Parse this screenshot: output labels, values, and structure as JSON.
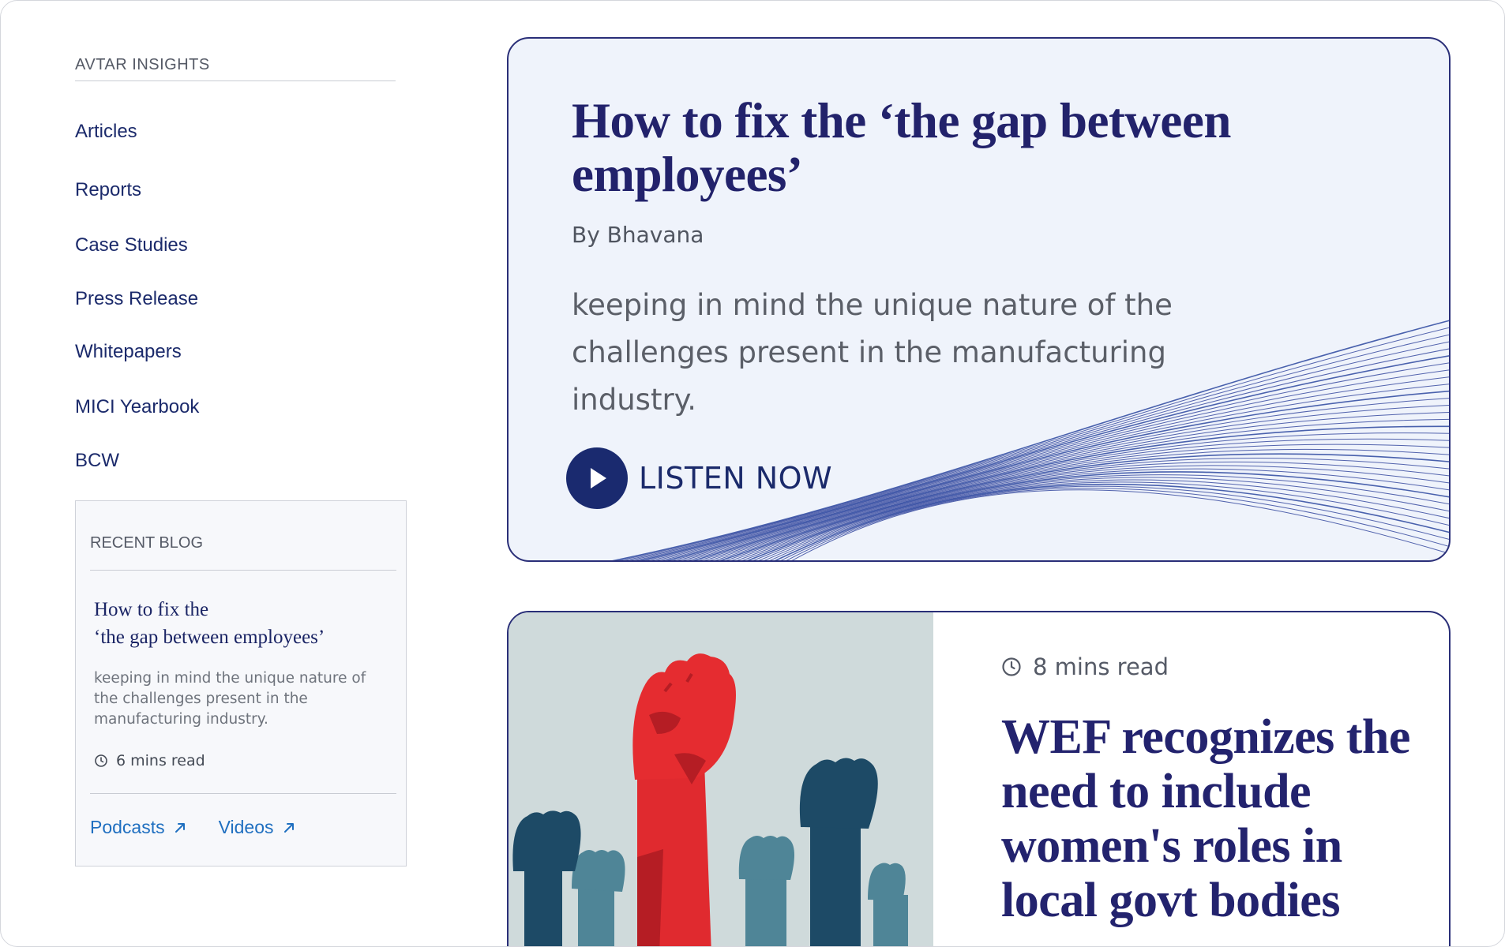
{
  "sidebar": {
    "heading": "AVTAR INSIGHTS",
    "nav": [
      "Articles",
      "Reports",
      "Case Studies",
      "Press Release",
      "Whitepapers",
      "MICI Yearbook",
      "BCW"
    ],
    "recent_blog": {
      "heading": "RECENT BLOG",
      "title_line1": "How to fix the",
      "title_line2": "‘the gap between employees’",
      "excerpt": "keeping in mind the unique nature of the challenges present in the manufacturing industry.",
      "read_time": "6 mins read",
      "links": [
        "Podcasts",
        "Videos"
      ]
    }
  },
  "feature": {
    "title": "How to fix the ‘the gap between employees’",
    "author": "By Bhavana",
    "excerpt": "keeping in mind the unique nature of the challenges present in the manufacturing industry.",
    "cta_label": "LISTEN NOW",
    "colors": {
      "accent": "#1a2a6f",
      "card_bg": "#eff3fb",
      "wave": "#2a3f9a"
    }
  },
  "second_card": {
    "read_time": "8 mins read",
    "title": "WEF recognizes the need to include women's roles in local govt bodies",
    "image_subject": "raised-fists-illustration",
    "colors": {
      "fist_highlight": "#e02a2f",
      "fist_dark": "#1a4a66",
      "image_bg": "#cfdadb"
    }
  },
  "icons": {
    "play": "play-icon",
    "clock": "clock-icon",
    "external": "arrow-up-right-icon"
  }
}
